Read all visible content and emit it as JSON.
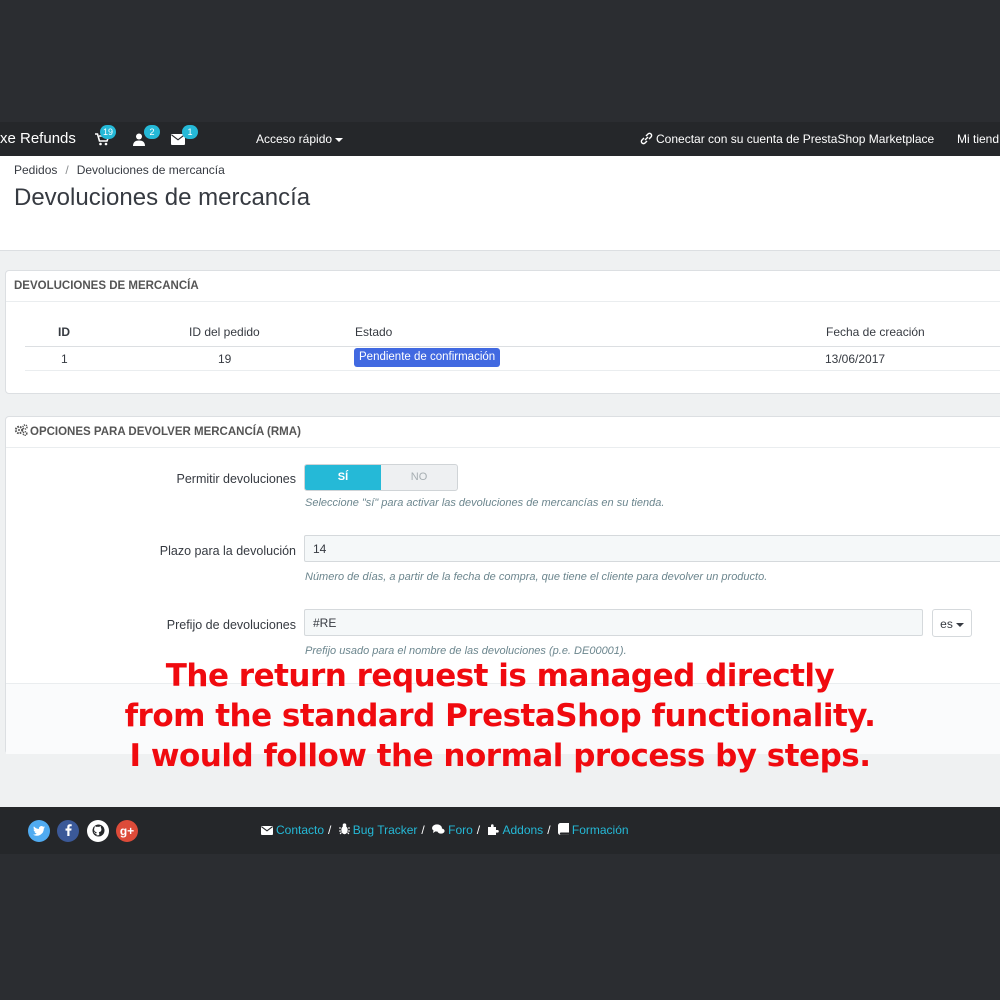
{
  "topbar": {
    "shop_name": "xe Refunds",
    "cart_count": "19",
    "customers_count": "2",
    "messages_count": "1",
    "quick_access": "Acceso rápido",
    "marketplace": "Conectar con su cuenta de PrestaShop Marketplace",
    "my_shop": "Mi tiend",
    "icons": [
      "shopping-cart-icon",
      "user-icon",
      "envelope-icon",
      "link-icon"
    ]
  },
  "header": {
    "breadcrumb": [
      "Pedidos",
      "Devoluciones de mercancía"
    ],
    "breadcrumb_separator": "/",
    "title": "Devoluciones de mercancía"
  },
  "returns_panel": {
    "heading": "DEVOLUCIONES DE MERCANCÍA",
    "columns": [
      "ID",
      "ID del pedido",
      "Estado",
      "Fecha de creación"
    ],
    "rows": [
      {
        "id": "1",
        "order_id": "19",
        "status": "Pendiente de confirmación",
        "date": "13/06/2017"
      }
    ]
  },
  "options_panel": {
    "heading": "OPCIONES PARA DEVOLVER MERCANCÍA (RMA)",
    "allow_label": "Permitir devoluciones",
    "allow_yes": "SÍ",
    "allow_no": "NO",
    "allow_value": "SÍ",
    "allow_help": "Seleccione \"sí\" para activar las devoluciones de mercancías en su tienda.",
    "deadline_label": "Plazo para la devolución",
    "deadline_value": "14",
    "deadline_help": "Número de días, a partir de la fecha de compra, que tiene el cliente para devolver un producto.",
    "prefix_label": "Prefijo de devoluciones",
    "prefix_value": "#RE",
    "prefix_lang": "es",
    "prefix_help": "Prefijo usado para el nombre de las devoluciones (p.e. DE00001)."
  },
  "overlay": {
    "lines": [
      "The return request is managed directly",
      "from the standard PrestaShop functionality.",
      "I would follow the normal process by steps."
    ],
    "color": "#f00a0f"
  },
  "footer": {
    "social": [
      {
        "name": "twitter-icon",
        "glyph": "t",
        "color": "#50abf1"
      },
      {
        "name": "facebook-icon",
        "glyph": "f",
        "color": "#3b5998"
      },
      {
        "name": "github-icon",
        "glyph": "",
        "color": "#ffffff"
      },
      {
        "name": "google-plus-icon",
        "glyph": "g+",
        "color": "#dd4b39"
      }
    ],
    "links": [
      "Contacto",
      "Bug Tracker",
      "Foro",
      "Addons",
      "Formación"
    ],
    "separator": "/"
  },
  "colors": {
    "accent": "#25b9d7",
    "status_badge": "#4169e1",
    "topbar": "#25272a"
  }
}
